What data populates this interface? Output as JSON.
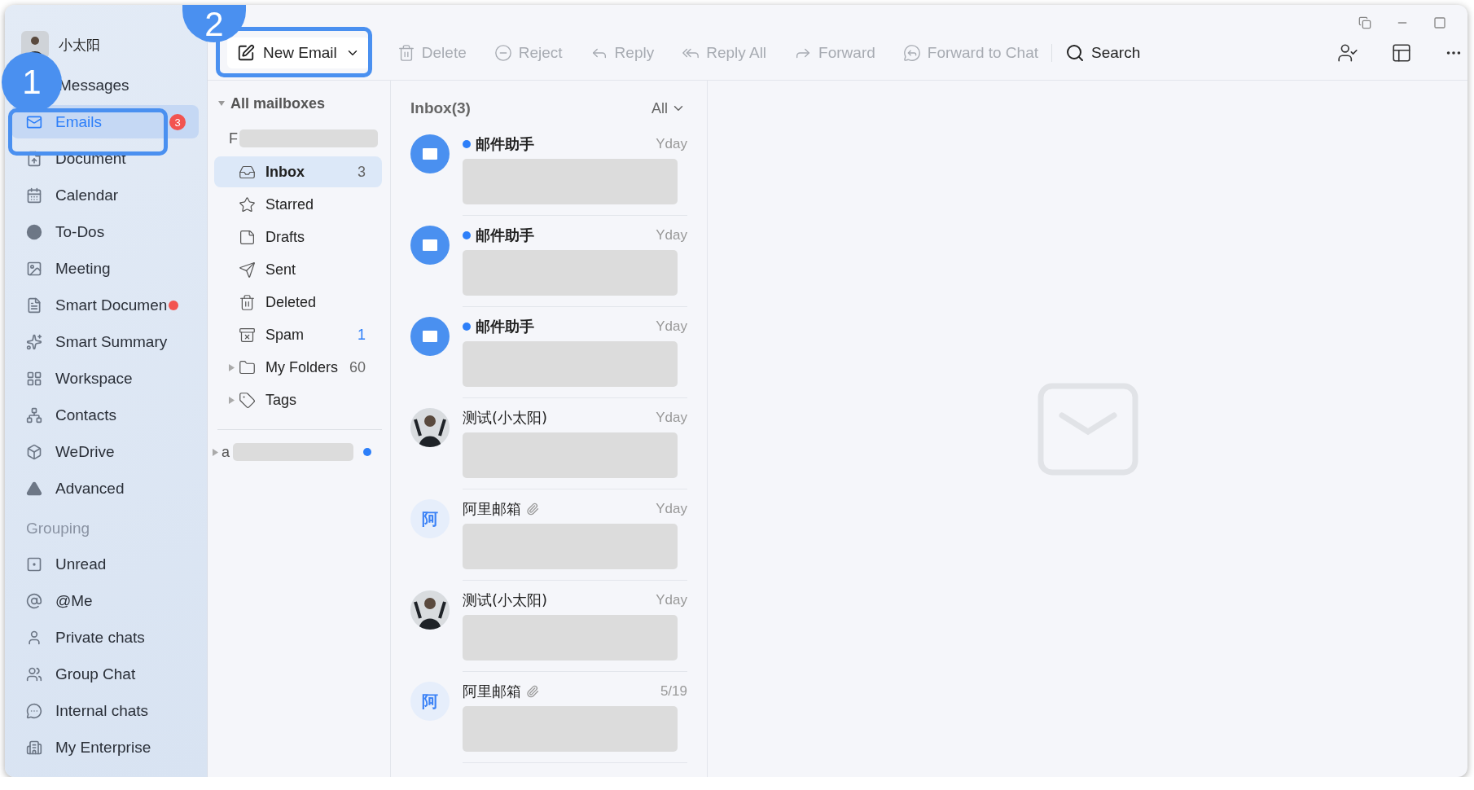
{
  "sidebar": {
    "user": {
      "name": "小太阳"
    },
    "items": [
      {
        "kind": "messages",
        "label": "Messages",
        "selected": false
      },
      {
        "kind": "mail",
        "label": "Emails",
        "selected": true,
        "badge": "3"
      },
      {
        "kind": "document",
        "label": "Document",
        "selected": false
      },
      {
        "kind": "calendar",
        "label": "Calendar",
        "selected": false
      },
      {
        "kind": "todo",
        "label": "To-Dos",
        "selected": false
      },
      {
        "kind": "meeting",
        "label": "Meeting",
        "selected": false
      },
      {
        "kind": "smartdoc",
        "label": "Smart Documen",
        "selected": false,
        "dot": true
      },
      {
        "kind": "sparkle",
        "label": "Smart Summary",
        "selected": false
      },
      {
        "kind": "workspace",
        "label": "Workspace",
        "selected": false
      },
      {
        "kind": "contacts",
        "label": "Contacts",
        "selected": false
      },
      {
        "kind": "drive",
        "label": "WeDrive",
        "selected": false
      },
      {
        "kind": "advanced",
        "label": "Advanced",
        "selected": false
      }
    ],
    "group_title": "Grouping",
    "groups": [
      {
        "kind": "unread",
        "label": "Unread"
      },
      {
        "kind": "at",
        "label": "@Me"
      },
      {
        "kind": "private",
        "label": "Private chats"
      },
      {
        "kind": "group",
        "label": "Group Chat"
      },
      {
        "kind": "internal",
        "label": "Internal chats"
      },
      {
        "kind": "enterprise",
        "label": "My Enterprise"
      }
    ]
  },
  "callouts": [
    {
      "number": "1"
    },
    {
      "number": "2"
    }
  ],
  "toolbar": {
    "new_email": "New Email",
    "actions": [
      {
        "kind": "delete",
        "label": "Delete",
        "disabled": true
      },
      {
        "kind": "reject",
        "label": "Reject",
        "disabled": true
      },
      {
        "kind": "reply",
        "label": "Reply",
        "disabled": true
      },
      {
        "kind": "replyall",
        "label": "Reply All",
        "disabled": true
      },
      {
        "kind": "forward",
        "label": "Forward",
        "disabled": true
      },
      {
        "kind": "chat",
        "label": "Forward to Chat",
        "disabled": true
      }
    ],
    "search": "Search"
  },
  "folders": {
    "title": "All mailboxes",
    "expanded": true,
    "account": "F",
    "items": [
      {
        "kind": "inbox",
        "label": "Inbox",
        "count": "3",
        "selected": true
      },
      {
        "kind": "star",
        "label": "Starred",
        "selected": false
      },
      {
        "kind": "drafts",
        "label": "Drafts",
        "selected": false
      },
      {
        "kind": "sent",
        "label": "Sent",
        "selected": false
      },
      {
        "kind": "deleted",
        "label": "Deleted",
        "selected": false
      },
      {
        "kind": "spam",
        "label": "Spam",
        "count": "1",
        "count_highlight": true,
        "selected": false
      },
      {
        "kind": "folder",
        "label": "My Folders",
        "count": "60",
        "expandable": true,
        "selected": false
      },
      {
        "kind": "tag",
        "label": "Tags",
        "expandable": true,
        "selected": false
      }
    ],
    "second_account": {
      "label": "a",
      "unread": true
    }
  },
  "messages": {
    "title": "Inbox(3)",
    "filter": "All",
    "items": [
      {
        "kind": "mail",
        "sender": "邮件助手",
        "time": "Yday",
        "unread": true,
        "attachment": false
      },
      {
        "kind": "mail",
        "sender": "邮件助手",
        "time": "Yday",
        "unread": true,
        "attachment": false
      },
      {
        "kind": "mail",
        "sender": "邮件助手",
        "time": "Yday",
        "unread": true,
        "attachment": false
      },
      {
        "kind": "photo",
        "sender": "测试(小太阳)",
        "time": "Yday",
        "unread": false,
        "attachment": false
      },
      {
        "kind": "letter",
        "letter": "阿",
        "sender": "阿里邮箱",
        "time": "Yday",
        "unread": false,
        "attachment": true
      },
      {
        "kind": "photo",
        "sender": "测试(小太阳)",
        "time": "Yday",
        "unread": false,
        "attachment": false
      },
      {
        "kind": "letter",
        "letter": "阿",
        "sender": "阿里邮箱",
        "time": "5/19",
        "unread": false,
        "attachment": true
      }
    ]
  }
}
